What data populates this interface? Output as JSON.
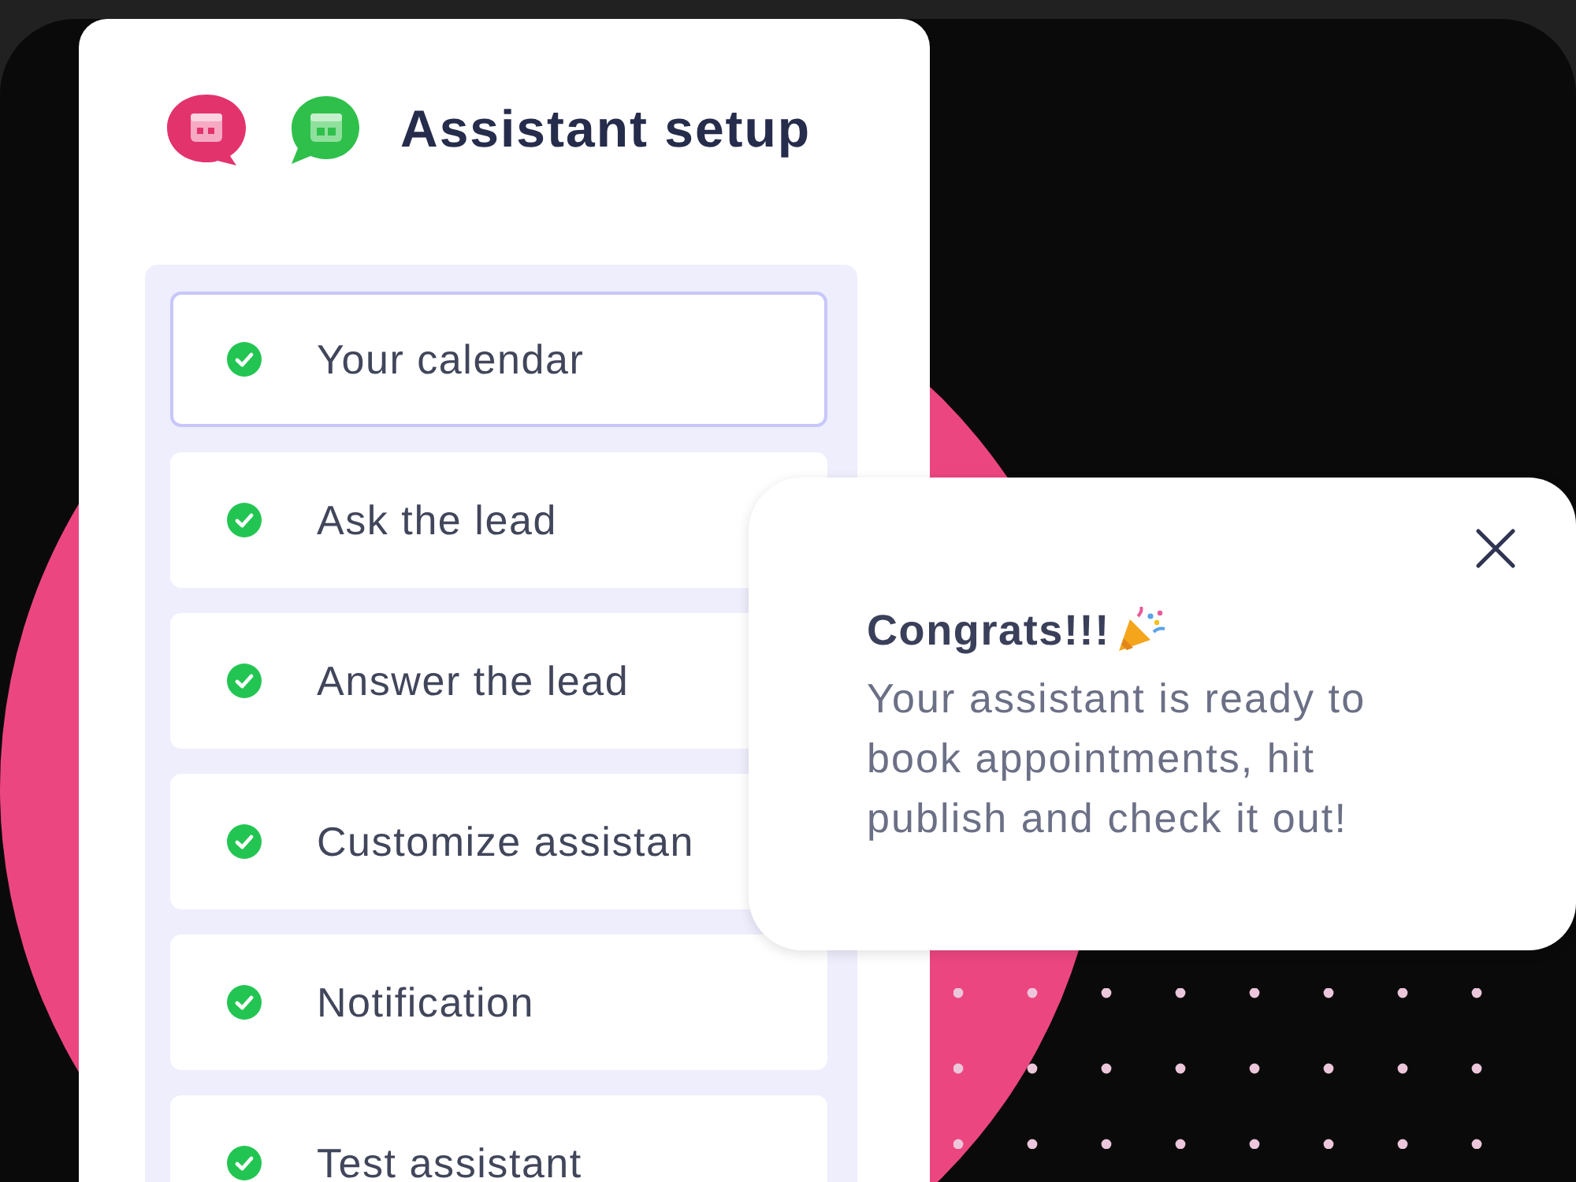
{
  "header": {
    "title": "Assistant setup"
  },
  "steps": [
    {
      "label": "Your calendar",
      "completed": true,
      "selected": true
    },
    {
      "label": "Ask the lead",
      "completed": true,
      "selected": false
    },
    {
      "label": "Answer the lead",
      "completed": true,
      "selected": false
    },
    {
      "label": "Customize assistan",
      "completed": true,
      "selected": false
    },
    {
      "label": "Notification",
      "completed": true,
      "selected": false
    },
    {
      "label": "Test assistant",
      "completed": true,
      "selected": false
    }
  ],
  "popup": {
    "title": "Congrats!!!",
    "message": "Your assistant is ready to book appointments, hit publish and check it out!"
  }
}
